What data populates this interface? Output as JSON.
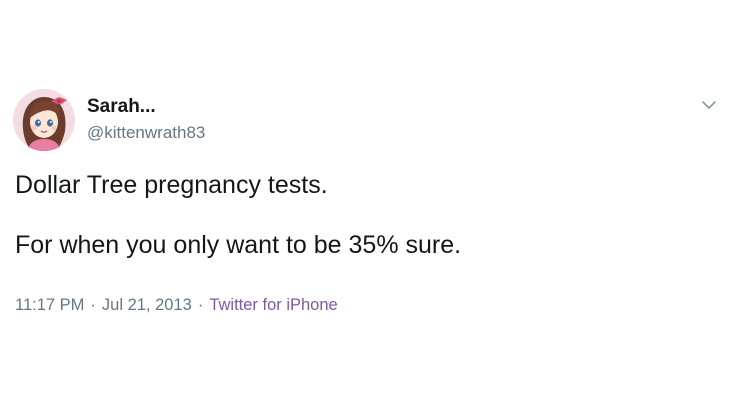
{
  "tweet": {
    "author": {
      "display_name": "Sarah...",
      "handle": "@kittenwrath83",
      "avatar": "illustrated-girl-avatar"
    },
    "menu_icon": "chevron-down-icon",
    "text_lines": [
      "Dollar Tree pregnancy tests.",
      "For when you only want to be 35% sure."
    ],
    "meta": {
      "time": "11:17 PM",
      "separator": "·",
      "date": "Jul 21, 2013",
      "source": "Twitter for iPhone"
    }
  },
  "colors": {
    "text_primary": "#14171a",
    "text_secondary": "#657786",
    "source_link": "#7b5aa6",
    "background": "#ffffff"
  }
}
